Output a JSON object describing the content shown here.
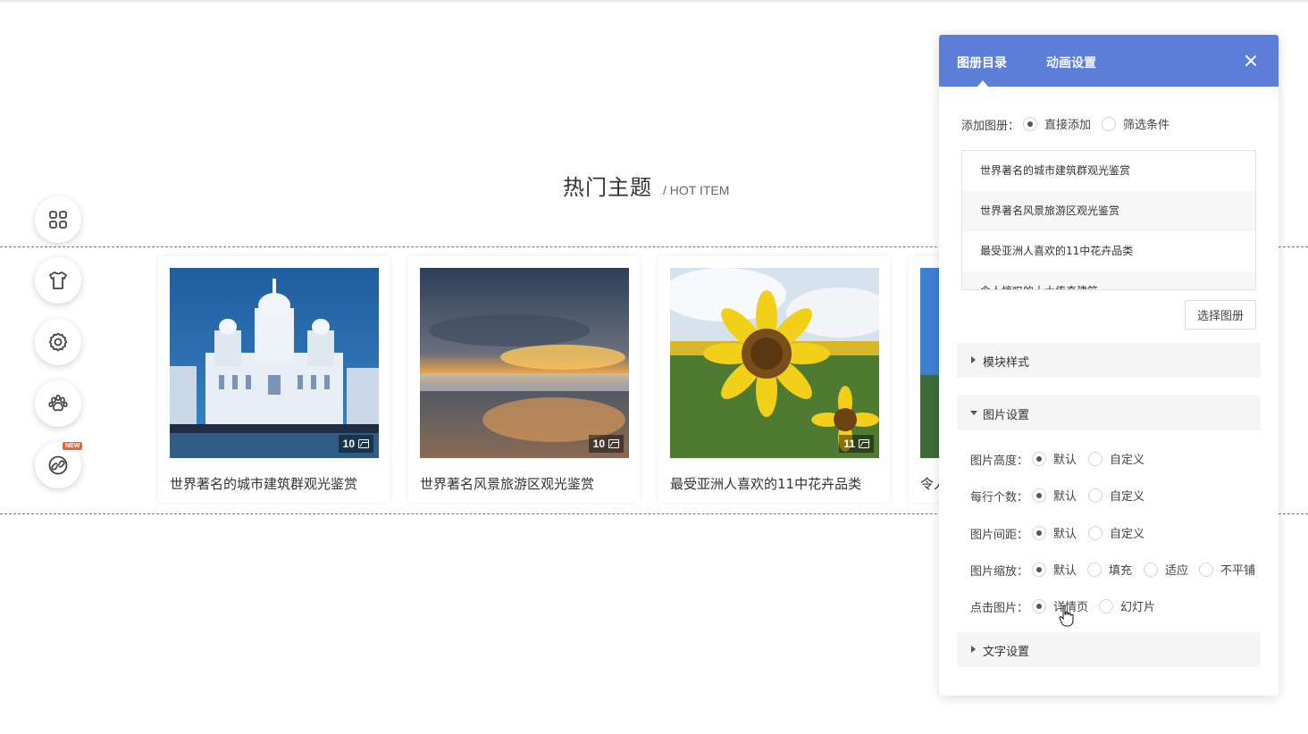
{
  "section": {
    "title": "热门主题",
    "subtitle": "/ HOT ITEM"
  },
  "toolbar": {
    "items": [
      {
        "icon": "grid-icon"
      },
      {
        "icon": "tshirt-icon"
      },
      {
        "icon": "gear-icon"
      },
      {
        "icon": "paw-icon"
      },
      {
        "icon": "link-icon",
        "badge": "NEW"
      }
    ]
  },
  "cards": [
    {
      "title": "世界著名的城市建筑群观光鉴赏",
      "count": "10"
    },
    {
      "title": "世界著名风景旅游区观光鉴赏",
      "count": "10"
    },
    {
      "title": "最受亚洲人喜欢的11中花卉品类",
      "count": "11"
    },
    {
      "title": "令人"
    }
  ],
  "panel": {
    "tabs": [
      "图册目录",
      "动画设置"
    ],
    "add_album": {
      "label": "添加图册：",
      "options": [
        "直接添加",
        "筛选条件"
      ],
      "selected": 0
    },
    "albums": [
      "世界著名的城市建筑群观光鉴赏",
      "世界著名风景旅游区观光鉴赏",
      "最受亚洲人喜欢的11中花卉品类",
      "令人惊叹的十大传奇建筑"
    ],
    "select_button": "选择图册",
    "sections": {
      "module_style": "模块样式",
      "image_settings": "图片设置",
      "text_settings": "文字设置"
    },
    "image_settings": [
      {
        "label": "图片高度：",
        "options": [
          "默认",
          "自定义"
        ],
        "selected": 0
      },
      {
        "label": "每行个数：",
        "options": [
          "默认",
          "自定义"
        ],
        "selected": 0
      },
      {
        "label": "图片间距：",
        "options": [
          "默认",
          "自定义"
        ],
        "selected": 0
      },
      {
        "label": "图片缩放：",
        "options": [
          "默认",
          "填充",
          "适应",
          "不平铺"
        ],
        "selected": 0
      },
      {
        "label": "点击图片：",
        "options": [
          "详情页",
          "幻灯片"
        ],
        "selected": 0
      }
    ]
  },
  "colors": {
    "accent": "#5b7fd8",
    "badge": "#e8683a"
  }
}
